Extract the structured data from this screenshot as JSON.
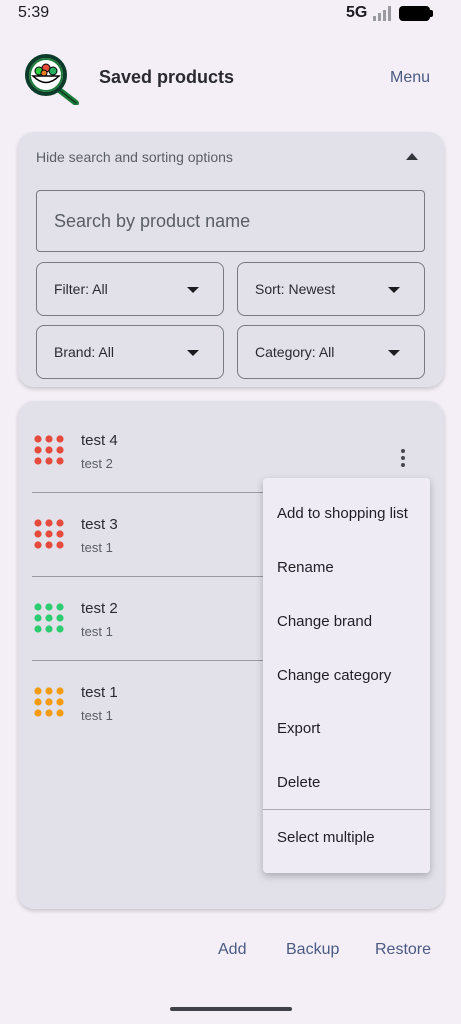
{
  "status_bar": {
    "time": "5:39",
    "network": "5G",
    "icons": [
      "signal-icon",
      "battery-icon"
    ]
  },
  "header": {
    "title": "Saved products",
    "menu_label": "Menu",
    "logo_icon": "magnifier-salad-logo"
  },
  "search_panel": {
    "toggle_label": "Hide search and sorting options",
    "search_placeholder": "Search by product name",
    "filter_label": "Filter: All",
    "sort_label": "Sort: Newest",
    "brand_label": "Brand: All",
    "category_label": "Category: All"
  },
  "products": [
    {
      "name": "test 4",
      "brand": "test 2",
      "color": "#e54b3c"
    },
    {
      "name": "test 3",
      "brand": "test 1",
      "color": "#e54b3c"
    },
    {
      "name": "test 2",
      "brand": "test 1",
      "color": "#2ecc71"
    },
    {
      "name": "test 1",
      "brand": "test 1",
      "color": "#f39c12"
    }
  ],
  "context_menu": {
    "items": [
      "Add to shopping list",
      "Rename",
      "Change brand",
      "Change category",
      "Export",
      "Delete",
      "Select multiple"
    ]
  },
  "bottom_actions": {
    "add": "Add",
    "backup": "Backup",
    "restore": "Restore"
  },
  "colors": {
    "accent": "#4a5a82",
    "card": "#e2e1ea",
    "background": "#f4eff7"
  }
}
